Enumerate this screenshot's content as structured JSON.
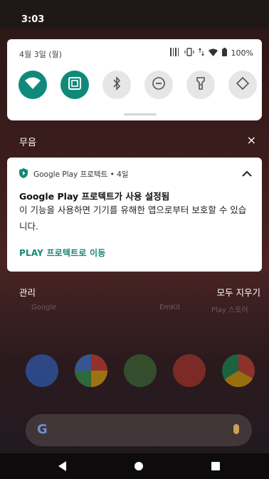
{
  "status_bar": {
    "time": "3:03"
  },
  "quick_settings": {
    "date": "4월 3일 (월)",
    "battery": "100%",
    "tiles": [
      {
        "name": "wifi",
        "active": true
      },
      {
        "name": "screenshot",
        "active": true
      },
      {
        "name": "bluetooth",
        "active": false
      },
      {
        "name": "do-not-disturb",
        "active": false
      },
      {
        "name": "flashlight",
        "active": false
      },
      {
        "name": "auto-rotate",
        "active": false
      }
    ]
  },
  "silent_section": {
    "label": "무음",
    "close": "×"
  },
  "notification": {
    "app_line": "Google Play 프로텍트 • 4일",
    "title": "Google Play 프로텍트가 사용 설정됨",
    "body": "이 기능을 사용하면 기기를 유해한 앱으로부터 보호할 수 있습니다.",
    "action": "PLAY 프로텍트로 이동"
  },
  "actions": {
    "manage": "관리",
    "clear_all": "모두 지우기"
  },
  "background_labels": [
    "Google",
    "EmKit",
    "Play 스토어"
  ],
  "colors": {
    "accent": "#0f8a7a",
    "action_text": "#138a71"
  }
}
